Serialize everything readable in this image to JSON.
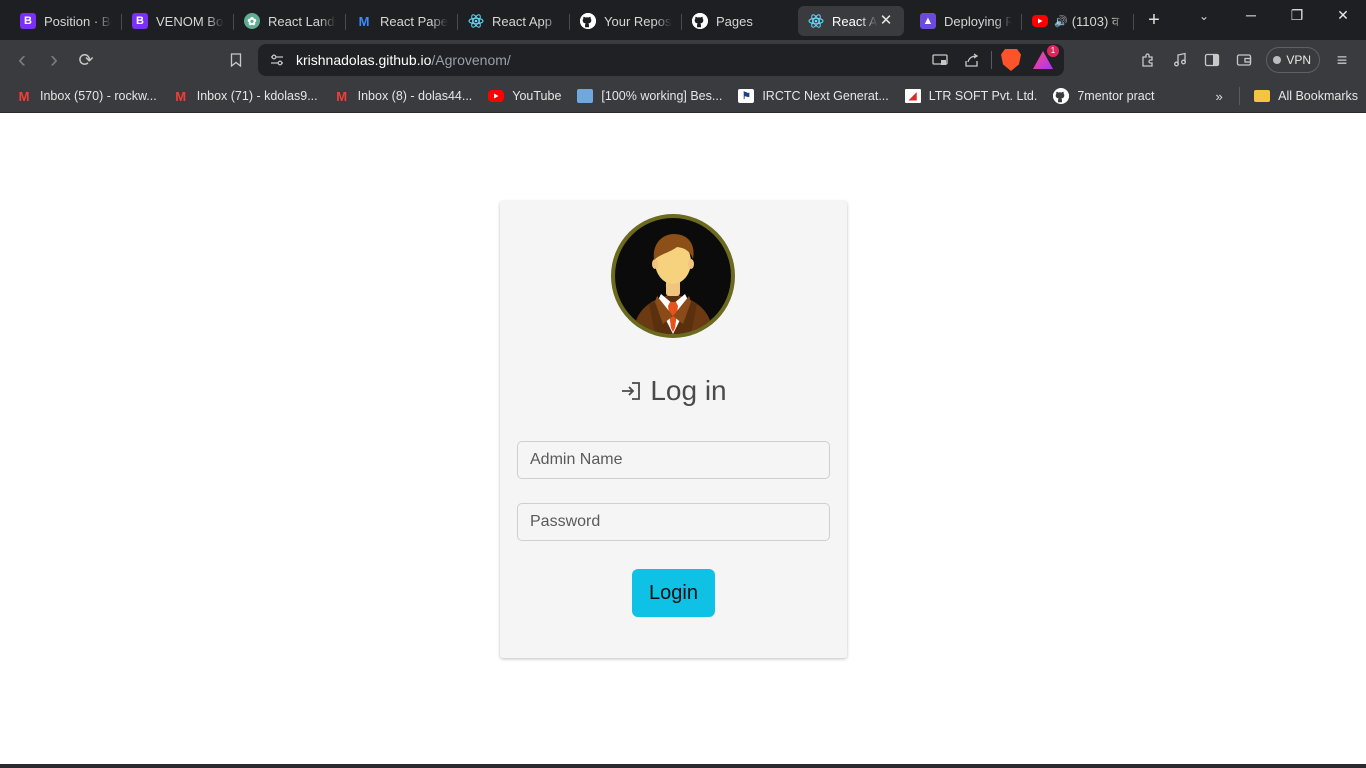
{
  "tabs": [
    {
      "label": "Position · Bootstrap",
      "favicon": "bootstrap-icon",
      "glyph": "B"
    },
    {
      "label": "VENOM Bootstrap",
      "favicon": "bootstrap-icon",
      "glyph": "B"
    },
    {
      "label": "React Landing",
      "favicon": "chatgpt-icon",
      "glyph": "✿"
    },
    {
      "label": "React Paper",
      "favicon": "mui-icon",
      "glyph": "M"
    },
    {
      "label": "React App",
      "favicon": "react-icon",
      "glyph": ""
    },
    {
      "label": "Your Repositories",
      "favicon": "github-icon",
      "glyph": ""
    },
    {
      "label": "Pages",
      "favicon": "github-icon",
      "glyph": ""
    },
    {
      "label": "React App",
      "favicon": "react-icon",
      "glyph": "",
      "active": true
    },
    {
      "label": "Deploying React",
      "favicon": "deploy-icon",
      "glyph": "▲"
    },
    {
      "label": "(1103) व",
      "favicon": "youtube-icon",
      "glyph": "",
      "audio": "🔊"
    }
  ],
  "window": {
    "close_glyph": "✕",
    "new_tab_glyph": "+",
    "minimize_glyph": "─",
    "restore_glyph": "❐",
    "search_tabs_glyph": "⌄"
  },
  "toolbar": {
    "back_glyph": "‹",
    "forward_glyph": "›",
    "reload_glyph": "⟳",
    "bookmark_glyph": "⌑",
    "site_info_glyph": "⚙",
    "url_host": "krishnadolas.github.io",
    "url_path": "/Agrovenom/",
    "cast_glyph": "▭",
    "share_glyph": "⇪",
    "rewards_badge": "1",
    "extensions_glyph": "✲",
    "media_glyph": "♫",
    "sidebar_glyph": "▯",
    "wallet_glyph": "▣",
    "vpn_label": "VPN",
    "menu_glyph": "≡"
  },
  "bookmarks": [
    {
      "label": "Inbox (570) - rockw...",
      "favicon": "gmail-icon",
      "glyph": "M"
    },
    {
      "label": "Inbox (71) - kdolas9...",
      "favicon": "gmail-icon",
      "glyph": "M"
    },
    {
      "label": "Inbox (8) - dolas44...",
      "favicon": "gmail-icon",
      "glyph": "M"
    },
    {
      "label": "YouTube",
      "favicon": "youtube-icon",
      "glyph": ""
    },
    {
      "label": "[100% working] Bes...",
      "favicon": "image-icon",
      "glyph": ""
    },
    {
      "label": "IRCTC Next Generat...",
      "favicon": "irctc-icon",
      "glyph": "⚑"
    },
    {
      "label": "LTR SOFT Pvt. Ltd.",
      "favicon": "ltr-icon",
      "glyph": "◢"
    },
    {
      "label": "7mentor pract",
      "favicon": "github-icon",
      "glyph": ""
    }
  ],
  "bookmarks_more_glyph": "»",
  "all_bookmarks_label": "All Bookmarks",
  "login": {
    "title": "Log in",
    "name_placeholder": "Admin Name",
    "password_placeholder": "Password",
    "button_label": "Login"
  },
  "colors": {
    "accent": "#10c1e6",
    "card_bg": "#f5f5f5",
    "browser_chrome": "#3a3b3f",
    "tab_strip": "#1e1f22"
  }
}
